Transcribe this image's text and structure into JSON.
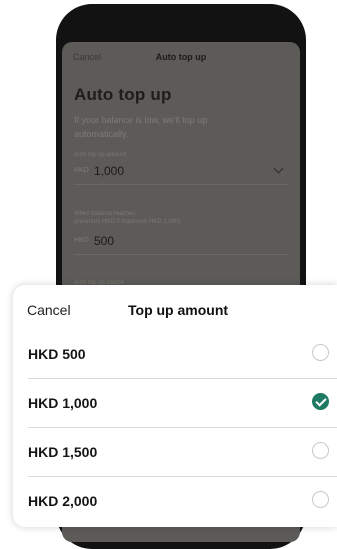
{
  "background_screen": {
    "nav": {
      "cancel_label": "Cancel",
      "title": "Auto top up"
    },
    "heading": "Auto top up",
    "description": "If your balance is low, we'll top up automatically.",
    "top_up_amount": {
      "label": "Auto top up amount",
      "currency": "HKD",
      "value": "1,000"
    },
    "threshold": {
      "label_line1": "When balance reaches",
      "label_line2": "(minimum HKD 0 maximum HKD 1,000)",
      "currency": "HKD",
      "value": "500"
    },
    "source_label": "Auto top up source"
  },
  "sheet": {
    "cancel_label": "Cancel",
    "title": "Top up amount",
    "options": [
      {
        "label": "HKD 500",
        "selected": false
      },
      {
        "label": "HKD 1,000",
        "selected": true
      },
      {
        "label": "HKD 1,500",
        "selected": false
      },
      {
        "label": "HKD 2,000",
        "selected": false
      }
    ]
  },
  "colors": {
    "accent": "#1f7a63",
    "overlay": "#5d5b58"
  }
}
